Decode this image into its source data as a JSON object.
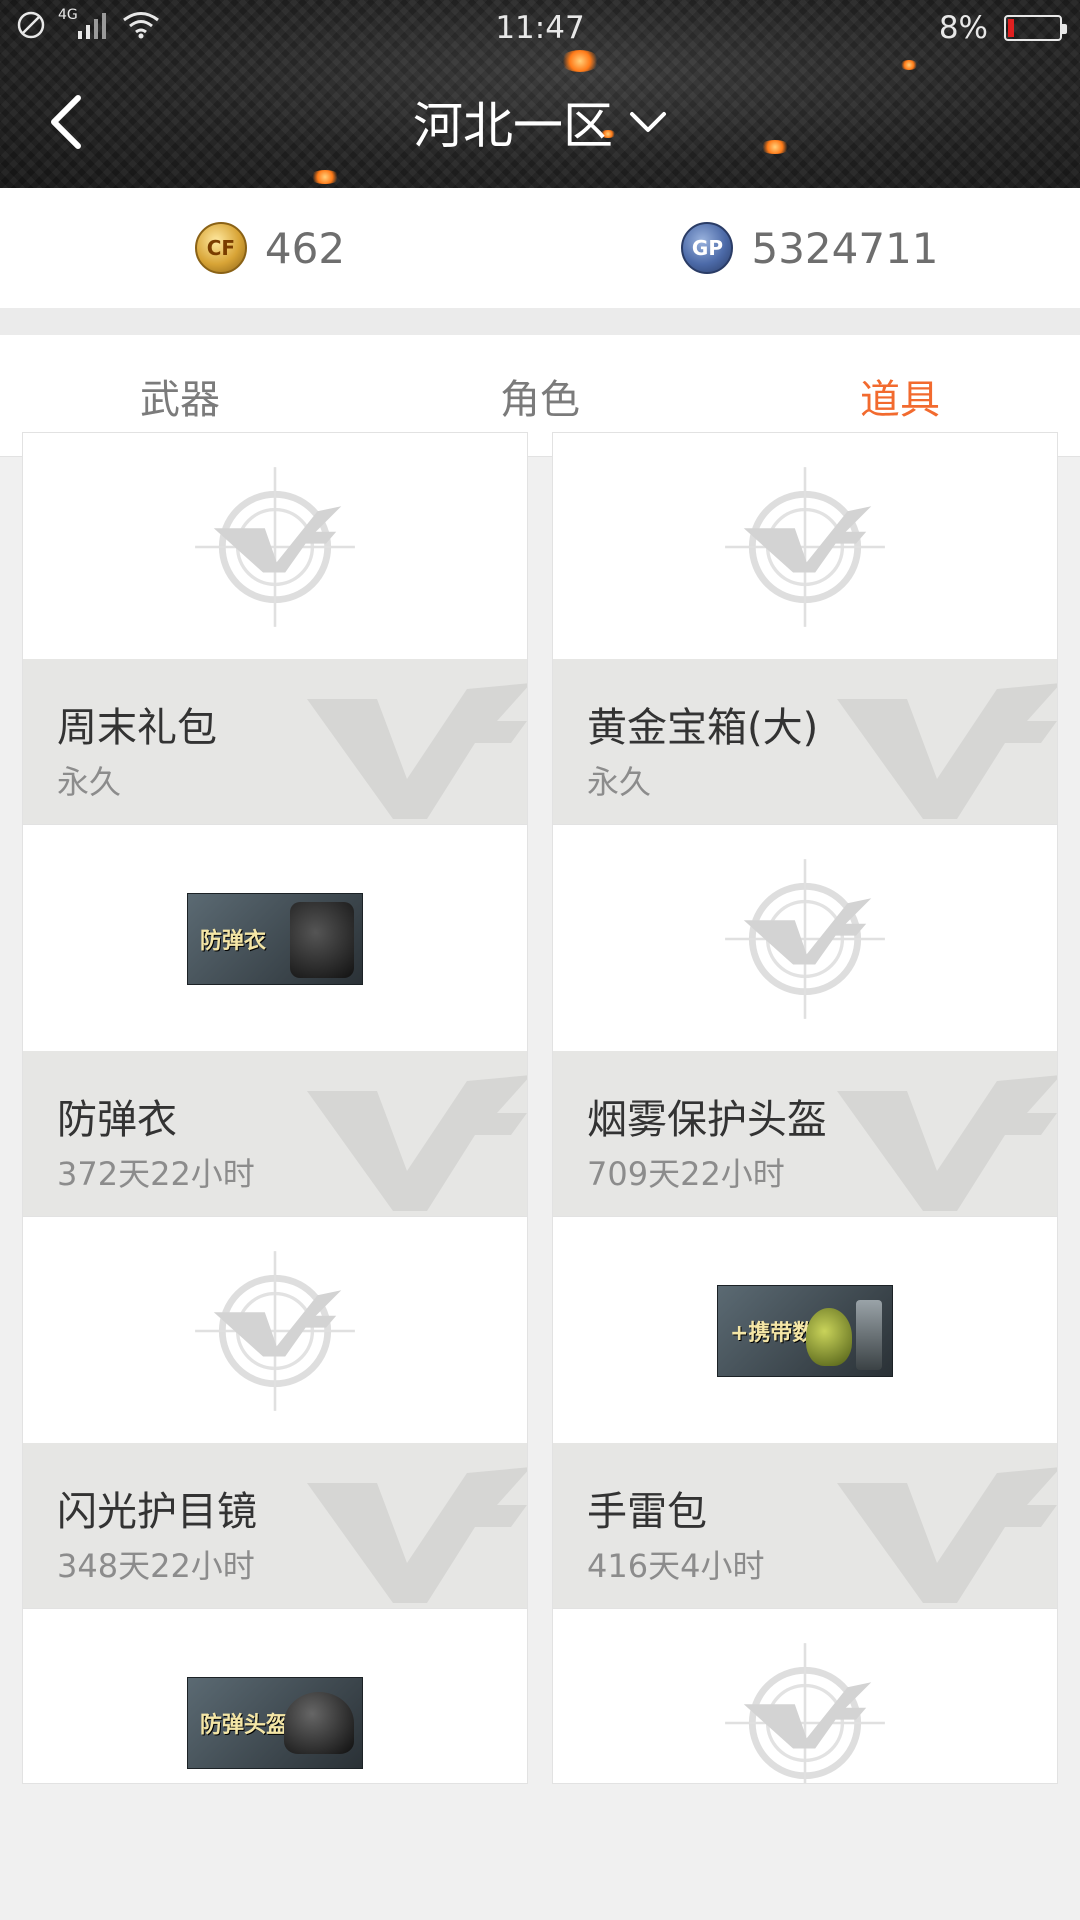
{
  "status_bar": {
    "network": "4G",
    "time": "11:47",
    "battery": "8%"
  },
  "nav": {
    "title": "河北一区"
  },
  "currency": {
    "cf_points": "462",
    "gp": "5324711",
    "cf_icon_text": "CF",
    "gp_icon_text": "GP"
  },
  "tabs": [
    {
      "label": "武器"
    },
    {
      "label": "角色"
    },
    {
      "label": "道具"
    }
  ],
  "active_tab": 2,
  "items": [
    {
      "name": "周末礼包",
      "duration": "永久",
      "image": "placeholder"
    },
    {
      "name": "黄金宝箱(大)",
      "duration": "永久",
      "image": "placeholder"
    },
    {
      "name": "防弹衣",
      "duration": "372天22小时",
      "image": "防弹衣"
    },
    {
      "name": "烟雾保护头盔",
      "duration": "709天22小时",
      "image": "placeholder"
    },
    {
      "name": "闪光护目镜",
      "duration": "348天22小时",
      "image": "placeholder"
    },
    {
      "name": "手雷包",
      "duration": "416天4小时",
      "image": "+携带数"
    },
    {
      "name": "",
      "duration": "",
      "image": "防弹头盔"
    },
    {
      "name": "",
      "duration": "",
      "image": "placeholder"
    }
  ],
  "colors": {
    "accent": "#f26a2e",
    "card_info_bg": "#e6e6e4"
  }
}
